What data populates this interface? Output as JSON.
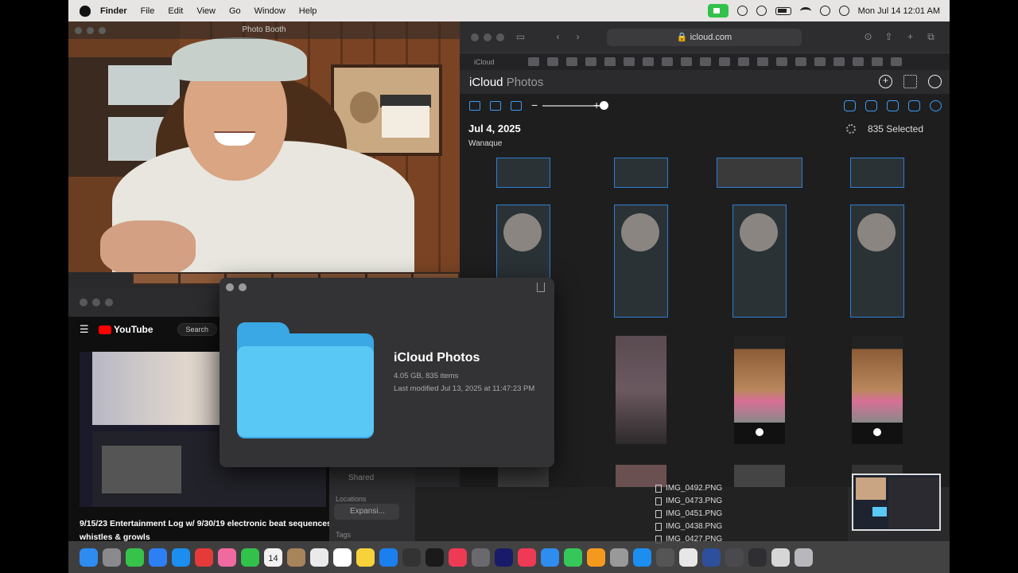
{
  "menubar": {
    "app": "Finder",
    "items": [
      "File",
      "Edit",
      "View",
      "Go",
      "Window",
      "Help"
    ],
    "clock": "Mon Jul 14  12:01 AM"
  },
  "photobooth": {
    "title": "Photo Booth"
  },
  "safari": {
    "url": "icloud.com",
    "first_tab": "iCloud",
    "brand": "iCloud",
    "section": "Photos",
    "date_title": "Jul 4, 2025",
    "location": "Wanaque",
    "selected": "835 Selected",
    "zoom_minus": "−",
    "zoom_plus": "+"
  },
  "youtube": {
    "logo": "YouTube",
    "search": "Search",
    "caption": "9/15/23 Entertainment Log w/ 9/30/19 electronic beat sequences whistles & growls"
  },
  "finder_sidebar": {
    "shared": "Shared",
    "locations": "Locations",
    "drive": "Expansi...",
    "tags": "Tags"
  },
  "finder_files": [
    "IMG_0492.PNG",
    "IMG_0473.PNG",
    "IMG_0451.PNG",
    "IMG_0438.PNG",
    "IMG_0427.PNG"
  ],
  "quicklook": {
    "title": "iCloud Photos",
    "size": "4.05 GB, 835 items",
    "modified": "Last modified Jul 13, 2025 at 11:47:23 PM"
  },
  "dock": {
    "calendar_day": "14",
    "colors": [
      "#2e8cf0",
      "#8a8a8e",
      "#37c24a",
      "#2d7ff5",
      "#1b8ef0",
      "#e53a3a",
      "#f06aa0",
      "#32c14a",
      "#f2f2f2",
      "#a7845a",
      "#eaeaea",
      "#ffffff",
      "#f7d23a",
      "#1c7ff0",
      "#333",
      "#1a1a1a",
      "#ef3a55",
      "#6a6a6e",
      "#1a1a6a",
      "#ef3a55",
      "#2f8df0",
      "#35c759",
      "#f39a1e",
      "#999",
      "#1b8ef0",
      "#555",
      "#e7e7e7",
      "#2d4f9c",
      "#4a4a4e",
      "#2f2f33",
      "#d6d6d6",
      "#b8b8bc"
    ]
  }
}
